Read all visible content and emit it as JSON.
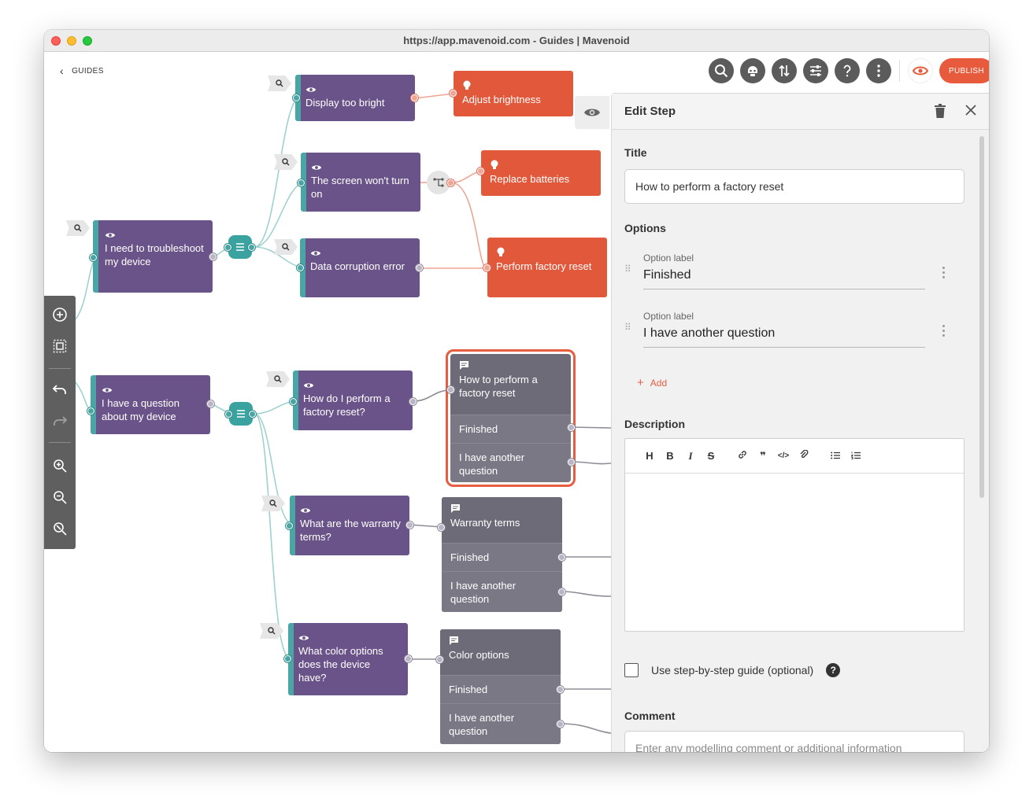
{
  "window": {
    "title": "https://app.mavenoid.com - Guides | Mavenoid"
  },
  "nav": {
    "back_label": "GUIDES"
  },
  "toolbar": {
    "publish_label": "PUBLISH"
  },
  "nodes": {
    "display_bright": "Display too bright",
    "screen_wont": "The screen won't turn on",
    "data_corruption": "Data corruption error",
    "troubleshoot": "I need to troubleshoot my device",
    "question": "I have a question about my device",
    "factory_q": "How do I perform a factory reset?",
    "warranty_q": "What are the warranty terms?",
    "color_q": "What color options does the device have?",
    "adjust_brightness": "Adjust brightness",
    "replace_batteries": "Replace batteries",
    "perform_reset": "Perform factory reset",
    "msg_factory": {
      "title": "How to perform a factory reset",
      "opt1": "Finished",
      "opt2": "I have another question"
    },
    "msg_warranty": {
      "title": "Warranty terms",
      "opt1": "Finished",
      "opt2": "I have another question"
    },
    "msg_color": {
      "title": "Color options",
      "opt1": "Finished",
      "opt2": "I have another question"
    }
  },
  "panel": {
    "header": "Edit Step",
    "title_label": "Title",
    "title_value": "How to perform a factory reset",
    "options_label": "Options",
    "option_small_label": "Option label",
    "options": [
      "Finished",
      "I have another question"
    ],
    "add_label": "Add",
    "description_label": "Description",
    "step_guide_label": "Use step-by-step guide (optional)",
    "comment_label": "Comment",
    "comment_placeholder": "Enter any modelling comment or additional information"
  },
  "colors": {
    "question": "#6a5389",
    "solution": "#e1583b",
    "message": "#75737f",
    "accent": "#4aa5a5",
    "publish": "#e75a3c"
  }
}
